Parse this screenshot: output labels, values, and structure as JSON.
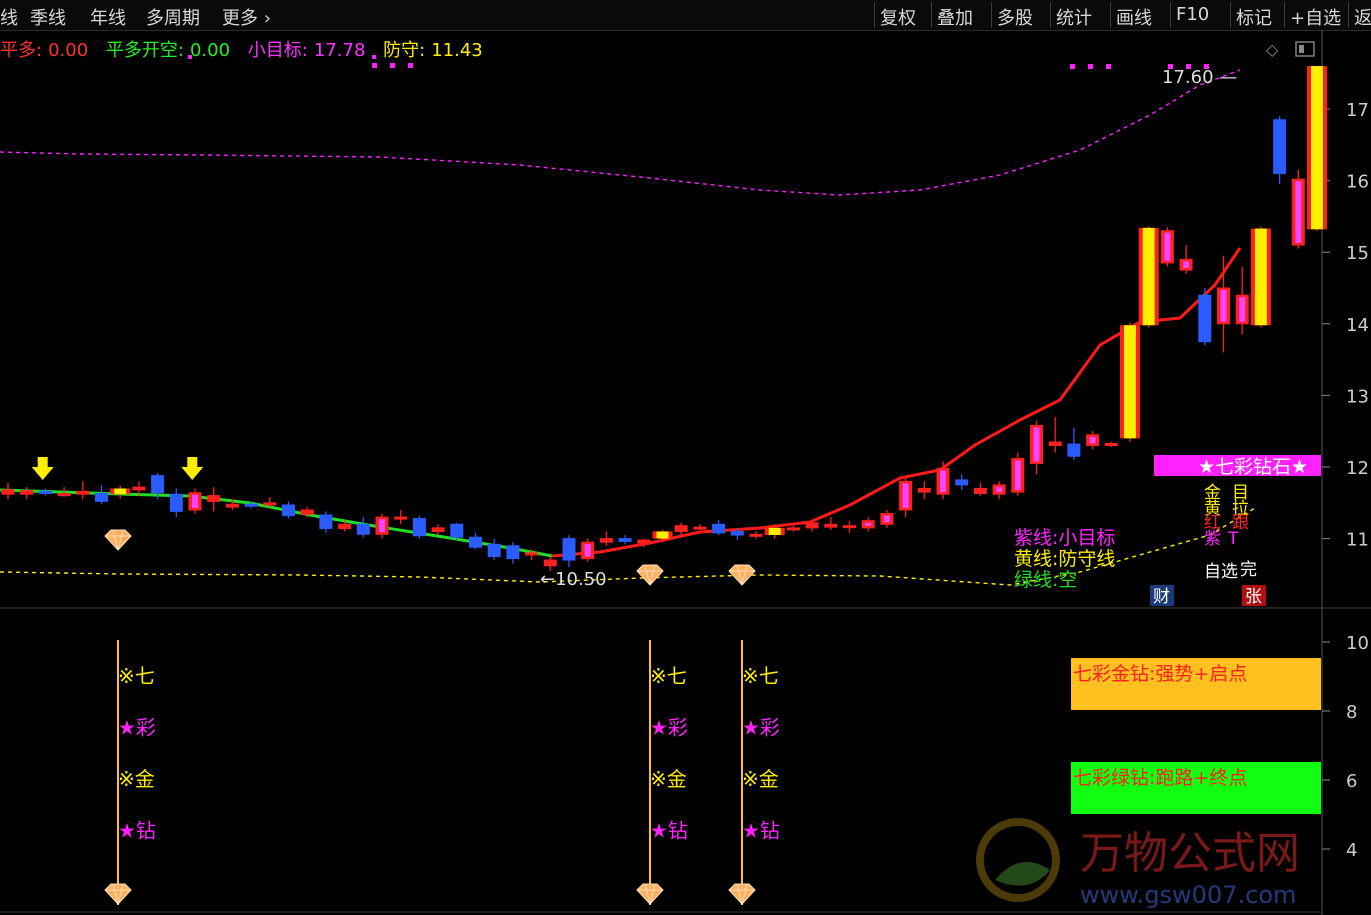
{
  "toolbar": {
    "left": [
      "线",
      "季线",
      "年线",
      "多周期",
      "更多"
    ],
    "right": [
      "复权",
      "叠加",
      "多股",
      "统计",
      "画线",
      "F10",
      "标记",
      "+自选",
      "返"
    ]
  },
  "indicator_line": {
    "pingduo_label": "平多:",
    "pingduo_value": "0.00",
    "pingduo_kaikong_label": "平多开空:",
    "pingduo_kaikong_value": "0.00",
    "target_label": "小目标:",
    "target_value": "17.78",
    "defense_label": "防守:",
    "defense_value": "11.43"
  },
  "colors": {
    "up": "#ff2020",
    "down": "#2a5cff",
    "green_line": "#22dd22",
    "red_line": "#ff1a1a",
    "magenta": "#ff22ff",
    "yellow": "#ffee00",
    "gold": "#ffc020",
    "bright_green": "#11ff11"
  },
  "chart_data": [
    {
      "type": "candlestick",
      "yticks": [
        "17",
        "16",
        "15",
        "14",
        "13",
        "12",
        "11"
      ],
      "ylim": [
        10.3,
        17.8
      ],
      "price_labels": {
        "high": "17.60",
        "low": "10.50"
      },
      "candles": [
        {
          "o": 11.68,
          "h": 11.78,
          "l": 11.55,
          "c": 11.62,
          "k": "up"
        },
        {
          "o": 11.62,
          "h": 11.72,
          "l": 11.55,
          "c": 11.67,
          "k": "up"
        },
        {
          "o": 11.66,
          "h": 11.7,
          "l": 11.6,
          "c": 11.63,
          "k": "down"
        },
        {
          "o": 11.63,
          "h": 11.72,
          "l": 11.58,
          "c": 11.6,
          "k": "up"
        },
        {
          "o": 11.62,
          "h": 11.8,
          "l": 11.55,
          "c": 11.66,
          "k": "up"
        },
        {
          "o": 11.63,
          "h": 11.75,
          "l": 11.48,
          "c": 11.52,
          "k": "down"
        },
        {
          "o": 11.62,
          "h": 11.74,
          "l": 11.56,
          "c": 11.7,
          "k": "gold"
        },
        {
          "o": 11.68,
          "h": 11.8,
          "l": 11.6,
          "c": 11.72,
          "k": "up"
        },
        {
          "o": 11.64,
          "h": 11.92,
          "l": 11.55,
          "c": 11.88,
          "k": "down"
        },
        {
          "o": 11.62,
          "h": 11.7,
          "l": 11.3,
          "c": 11.38,
          "k": "down"
        },
        {
          "o": 11.4,
          "h": 11.7,
          "l": 11.35,
          "c": 11.64,
          "k": "up"
        },
        {
          "o": 11.6,
          "h": 11.72,
          "l": 11.38,
          "c": 11.52,
          "k": "up"
        },
        {
          "o": 11.48,
          "h": 11.55,
          "l": 11.4,
          "c": 11.44,
          "k": "up"
        },
        {
          "o": 11.46,
          "h": 11.52,
          "l": 11.42,
          "c": 11.48,
          "k": "down"
        },
        {
          "o": 11.5,
          "h": 11.58,
          "l": 11.44,
          "c": 11.47,
          "k": "up"
        },
        {
          "o": 11.47,
          "h": 11.52,
          "l": 11.28,
          "c": 11.32,
          "k": "down"
        },
        {
          "o": 11.4,
          "h": 11.44,
          "l": 11.3,
          "c": 11.34,
          "k": "up"
        },
        {
          "o": 11.33,
          "h": 11.38,
          "l": 11.08,
          "c": 11.14,
          "k": "down"
        },
        {
          "o": 11.14,
          "h": 11.25,
          "l": 11.1,
          "c": 11.2,
          "k": "up"
        },
        {
          "o": 11.2,
          "h": 11.3,
          "l": 11.02,
          "c": 11.06,
          "k": "down"
        },
        {
          "o": 11.06,
          "h": 11.35,
          "l": 11.0,
          "c": 11.3,
          "k": "up"
        },
        {
          "o": 11.3,
          "h": 11.4,
          "l": 11.2,
          "c": 11.28,
          "k": "up"
        },
        {
          "o": 11.28,
          "h": 11.32,
          "l": 11.0,
          "c": 11.04,
          "k": "down"
        },
        {
          "o": 11.15,
          "h": 11.2,
          "l": 11.05,
          "c": 11.1,
          "k": "up"
        },
        {
          "o": 11.2,
          "h": 11.22,
          "l": 10.98,
          "c": 11.02,
          "k": "down"
        },
        {
          "o": 11.02,
          "h": 11.08,
          "l": 10.85,
          "c": 10.88,
          "k": "down"
        },
        {
          "o": 10.92,
          "h": 11.0,
          "l": 10.7,
          "c": 10.75,
          "k": "down"
        },
        {
          "o": 10.9,
          "h": 10.95,
          "l": 10.65,
          "c": 10.72,
          "k": "down"
        },
        {
          "o": 10.8,
          "h": 10.85,
          "l": 10.7,
          "c": 10.78,
          "k": "up"
        },
        {
          "o": 10.7,
          "h": 10.75,
          "l": 10.55,
          "c": 10.62,
          "k": "up"
        },
        {
          "o": 10.7,
          "h": 11.05,
          "l": 10.6,
          "c": 11.0,
          "k": "down"
        },
        {
          "o": 10.72,
          "h": 11.0,
          "l": 10.68,
          "c": 10.95,
          "k": "up"
        },
        {
          "o": 10.95,
          "h": 11.1,
          "l": 10.9,
          "c": 11.0,
          "k": "up"
        },
        {
          "o": 11.0,
          "h": 11.05,
          "l": 10.92,
          "c": 10.96,
          "k": "down"
        },
        {
          "o": 10.94,
          "h": 11.0,
          "l": 10.88,
          "c": 10.98,
          "k": "up"
        },
        {
          "o": 11.0,
          "h": 11.12,
          "l": 10.95,
          "c": 11.1,
          "k": "gold"
        },
        {
          "o": 11.1,
          "h": 11.22,
          "l": 11.05,
          "c": 11.18,
          "k": "up"
        },
        {
          "o": 11.15,
          "h": 11.2,
          "l": 11.12,
          "c": 11.16,
          "k": "up"
        },
        {
          "o": 11.08,
          "h": 11.26,
          "l": 11.05,
          "c": 11.2,
          "k": "down"
        },
        {
          "o": 11.1,
          "h": 11.15,
          "l": 10.98,
          "c": 11.05,
          "k": "down"
        },
        {
          "o": 11.04,
          "h": 11.1,
          "l": 11.0,
          "c": 11.06,
          "k": "up"
        },
        {
          "o": 11.05,
          "h": 11.2,
          "l": 11.0,
          "c": 11.15,
          "k": "gold"
        },
        {
          "o": 11.13,
          "h": 11.18,
          "l": 11.1,
          "c": 11.15,
          "k": "up"
        },
        {
          "o": 11.15,
          "h": 11.25,
          "l": 11.1,
          "c": 11.22,
          "k": "up"
        },
        {
          "o": 11.2,
          "h": 11.3,
          "l": 11.12,
          "c": 11.16,
          "k": "up"
        },
        {
          "o": 11.16,
          "h": 11.25,
          "l": 11.08,
          "c": 11.18,
          "k": "up"
        },
        {
          "o": 11.15,
          "h": 11.3,
          "l": 11.1,
          "c": 11.25,
          "k": "up"
        },
        {
          "o": 11.2,
          "h": 11.4,
          "l": 11.15,
          "c": 11.35,
          "k": "up"
        },
        {
          "o": 11.4,
          "h": 11.85,
          "l": 11.3,
          "c": 11.8,
          "k": "up"
        },
        {
          "o": 11.65,
          "h": 11.8,
          "l": 11.55,
          "c": 11.7,
          "k": "up"
        },
        {
          "o": 11.62,
          "h": 12.08,
          "l": 11.55,
          "c": 11.98,
          "k": "up"
        },
        {
          "o": 11.82,
          "h": 11.9,
          "l": 11.68,
          "c": 11.75,
          "k": "down"
        },
        {
          "o": 11.7,
          "h": 11.78,
          "l": 11.6,
          "c": 11.63,
          "k": "up"
        },
        {
          "o": 11.62,
          "h": 11.8,
          "l": 11.55,
          "c": 11.75,
          "k": "up"
        },
        {
          "o": 11.65,
          "h": 12.2,
          "l": 11.6,
          "c": 12.12,
          "k": "up"
        },
        {
          "o": 12.05,
          "h": 12.65,
          "l": 11.9,
          "c": 12.58,
          "k": "up"
        },
        {
          "o": 12.3,
          "h": 12.7,
          "l": 12.2,
          "c": 12.35,
          "k": "up"
        },
        {
          "o": 12.32,
          "h": 12.55,
          "l": 12.1,
          "c": 12.15,
          "k": "down"
        },
        {
          "o": 12.3,
          "h": 12.5,
          "l": 12.25,
          "c": 12.45,
          "k": "up"
        },
        {
          "o": 12.3,
          "h": 12.35,
          "l": 12.28,
          "c": 12.33,
          "k": "up"
        },
        {
          "o": 12.4,
          "h": 14.02,
          "l": 12.35,
          "c": 13.98,
          "k": "gold"
        },
        {
          "o": 13.98,
          "h": 15.36,
          "l": 13.95,
          "c": 15.34,
          "k": "gold"
        },
        {
          "o": 15.3,
          "h": 15.35,
          "l": 14.8,
          "c": 14.85,
          "k": "up"
        },
        {
          "o": 14.9,
          "h": 15.1,
          "l": 14.7,
          "c": 14.75,
          "k": "up"
        },
        {
          "o": 14.4,
          "h": 14.5,
          "l": 13.7,
          "c": 13.75,
          "k": "down"
        },
        {
          "o": 14.0,
          "h": 14.95,
          "l": 13.6,
          "c": 14.5,
          "k": "up"
        },
        {
          "o": 14.0,
          "h": 14.8,
          "l": 13.85,
          "c": 14.4,
          "k": "up"
        },
        {
          "o": 13.98,
          "h": 15.36,
          "l": 13.95,
          "c": 15.33,
          "k": "gold"
        },
        {
          "o": 16.1,
          "h": 16.9,
          "l": 15.95,
          "c": 16.85,
          "k": "down"
        },
        {
          "o": 15.1,
          "h": 16.15,
          "l": 15.05,
          "c": 16.02,
          "k": "up"
        },
        {
          "o": 15.32,
          "h": 17.6,
          "l": 15.3,
          "c": 17.6,
          "k": "gold"
        }
      ],
      "series": [
        {
          "name": "紫线",
          "color": "#ff22ff",
          "style": "dashed"
        },
        {
          "name": "黄线",
          "color": "#ffee00",
          "style": "dashed"
        },
        {
          "name": "绿线",
          "color": "#22dd22",
          "style": "solid"
        }
      ],
      "legend": [
        {
          "text": "紫线:小目标",
          "color": "#ff22ff"
        },
        {
          "text": "黄线:防守线",
          "color": "#ffee00"
        },
        {
          "text": "绿线:空",
          "color": "#22dd22"
        }
      ],
      "signals": {
        "yellow_arrows_at": [
          1,
          9
        ],
        "diamonds_at": [
          7,
          37,
          42
        ],
        "magenta_dots_top": "· · · ·"
      },
      "side_tags": {
        "banner": "★七彩钻石★",
        "stack": [
          {
            "text": "金",
            "color": "#ffee00"
          },
          {
            "text": "目",
            "color": "#ffee00"
          },
          {
            "text": "黄",
            "color": "#ffee00"
          },
          {
            "text": "拉",
            "color": "#ffee00"
          },
          {
            "text": "红",
            "color": "#ff2222"
          },
          {
            "text": "跟",
            "color": "#ff2222"
          },
          {
            "text": "紫",
            "color": "#ff22ff"
          },
          {
            "text": "T",
            "color": "#ff22ff"
          },
          {
            "text": "自选",
            "color": "#ffffff"
          },
          {
            "text": "完",
            "color": "#ffffff"
          }
        ],
        "badge_cai": "财",
        "badge_zhang": "张"
      }
    },
    {
      "type": "signal_panel",
      "yticks": [
        "10",
        "8",
        "6",
        "4"
      ],
      "signal_columns_at": [
        7,
        37,
        42
      ],
      "signal_text": [
        "※七",
        "★彩",
        "※金",
        "★钻"
      ],
      "boxes": [
        {
          "text": "七彩金钻:强势+启点",
          "bg": "#ffc020",
          "color": "#ff2020"
        },
        {
          "text": "七彩绿钻:跑路+终点",
          "bg": "#11ff11",
          "color": "#ff2020"
        }
      ]
    }
  ],
  "watermark": {
    "main": "万物公式网",
    "url": "www.gsw007.com"
  }
}
